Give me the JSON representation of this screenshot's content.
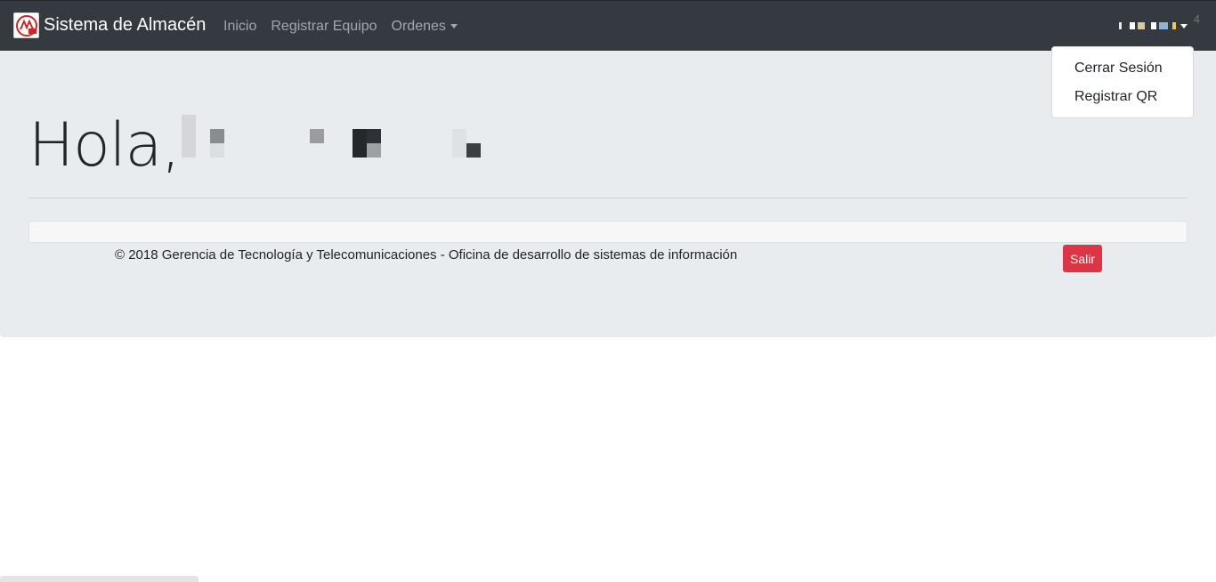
{
  "navbar": {
    "brand": "Sistema de Almacén",
    "links": [
      {
        "label": "Inicio"
      },
      {
        "label": "Registrar Equipo"
      },
      {
        "label": "Ordenes"
      }
    ],
    "user_count": "4",
    "logo_icon": "institution-logo-icon"
  },
  "user_menu": {
    "items": [
      {
        "label": "Cerrar Sesión"
      },
      {
        "label": "Registrar QR"
      }
    ]
  },
  "main": {
    "greeting": "Hola,"
  },
  "footer": {
    "copyright": "© 2018 Gerencia de Tecnología y Telecomunicaciones - Oficina de desarrollo de sistemas de información",
    "logout_label": "Salir"
  },
  "colors": {
    "navbar_bg": "#343a40",
    "jumbotron_bg": "#e9ecef",
    "danger": "#dc3545"
  }
}
